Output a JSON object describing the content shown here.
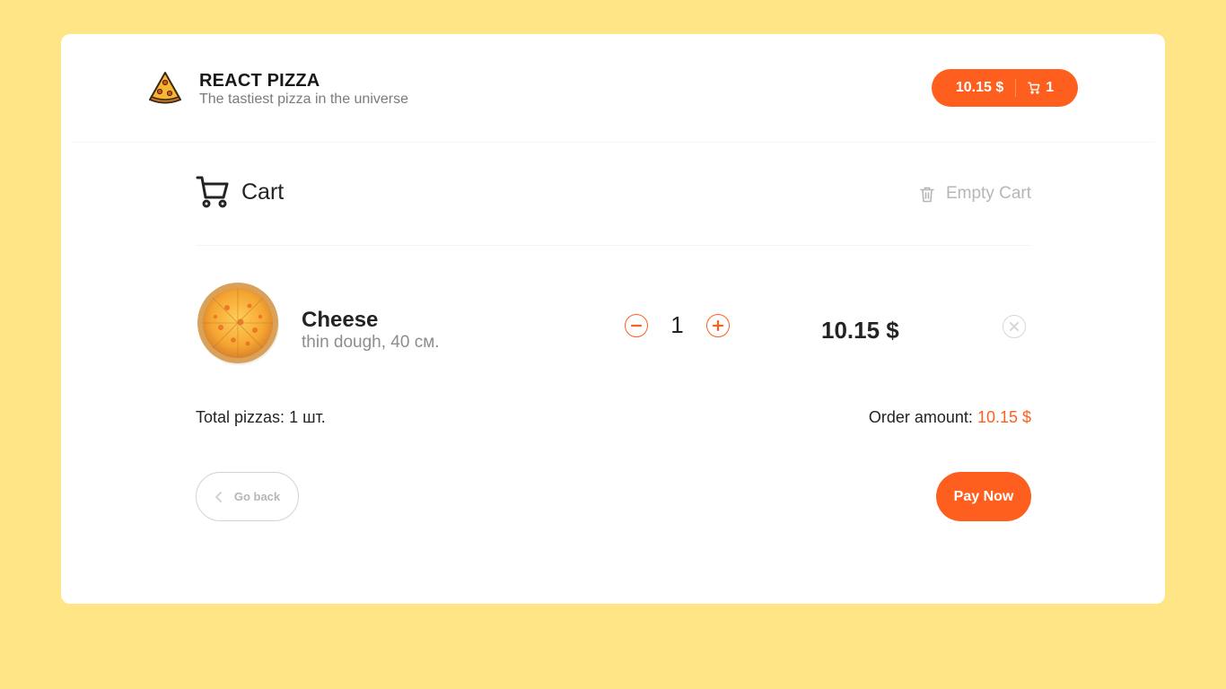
{
  "header": {
    "title": "REACT PIZZA",
    "subtitle": "The tastiest pizza in the universe",
    "cart_button": {
      "sum": "10.15 $",
      "count": "1"
    }
  },
  "cart": {
    "title": "Cart",
    "clear_label": "Empty Cart",
    "items": [
      {
        "name": "Cheese",
        "description": "thin dough, 40 см.",
        "count": "1",
        "price": "10.15 $",
        "image": "pizza-image"
      }
    ],
    "total_label": "Total pizzas:",
    "total_value": "1 шт.",
    "amount_label": "Order amount:",
    "amount_value": "10.15 $",
    "back_label": "Go back",
    "pay_label": "Pay Now"
  },
  "colors": {
    "accent": "#fe5f1e",
    "background": "#ffe585"
  },
  "icons": [
    "pizza-logo-icon",
    "cart-icon",
    "trash-icon",
    "minus-icon",
    "plus-icon",
    "close-icon",
    "chevron-left-icon"
  ]
}
